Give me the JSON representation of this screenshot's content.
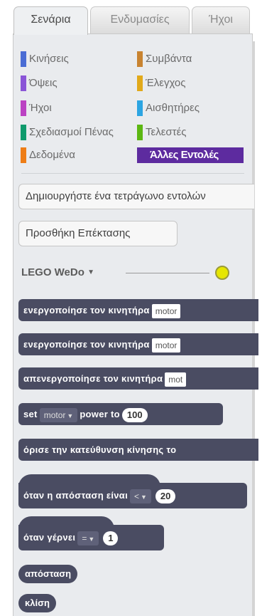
{
  "tabs": [
    "Σενάρια",
    "Ενδυμασίες",
    "Ήχοι"
  ],
  "categories": [
    {
      "label": "Κινήσεις",
      "color": "#4a6cd4"
    },
    {
      "label": "Συμβάντα",
      "color": "#c88330"
    },
    {
      "label": "Όψεις",
      "color": "#8a55d7"
    },
    {
      "label": "Έλεγχος",
      "color": "#e1a91a"
    },
    {
      "label": "Ήχοι",
      "color": "#bb42c3"
    },
    {
      "label": "Αισθητήρες",
      "color": "#2ca5e2"
    },
    {
      "label": "Σχεδιασμοί Πένας",
      "color": "#0e9a6c"
    },
    {
      "label": "Τελεστές",
      "color": "#5cb712"
    },
    {
      "label": "Δεδομένα",
      "color": "#ee7d16"
    },
    {
      "label": "Άλλες Εντολές",
      "color": "#5d2b9f"
    }
  ],
  "buttons": {
    "make_block": "Δημιουργήστε ένα τετράγωνο εντολών",
    "add_extension": "Προσθήκη Επέκτασης"
  },
  "wedo": {
    "title": "LEGO WeDo",
    "arrow": "▼",
    "status_color": "#e6e600"
  },
  "blocks": {
    "b1": {
      "text": "ενεργοποίησε τον κινητήρα",
      "field": "motor"
    },
    "b2": {
      "text": "ενεργοποίησε τον κινητήρα",
      "field": "motor"
    },
    "b3": {
      "text": "απενεργοποίησε τον κινητήρα",
      "field": "mot"
    },
    "b4": {
      "pre": "set",
      "dd": "motor",
      "post": "power to",
      "num": "100"
    },
    "b5": {
      "text": "όρισε την κατεύθυνση κίνησης το"
    },
    "b6": {
      "text": "όταν η απόσταση είναι",
      "dd": "<",
      "num": "20"
    },
    "b7": {
      "text": "όταν γέρνει",
      "dd": "=",
      "num": "1"
    },
    "r1": {
      "text": "απόσταση"
    },
    "r2": {
      "text": "κλίση"
    }
  }
}
